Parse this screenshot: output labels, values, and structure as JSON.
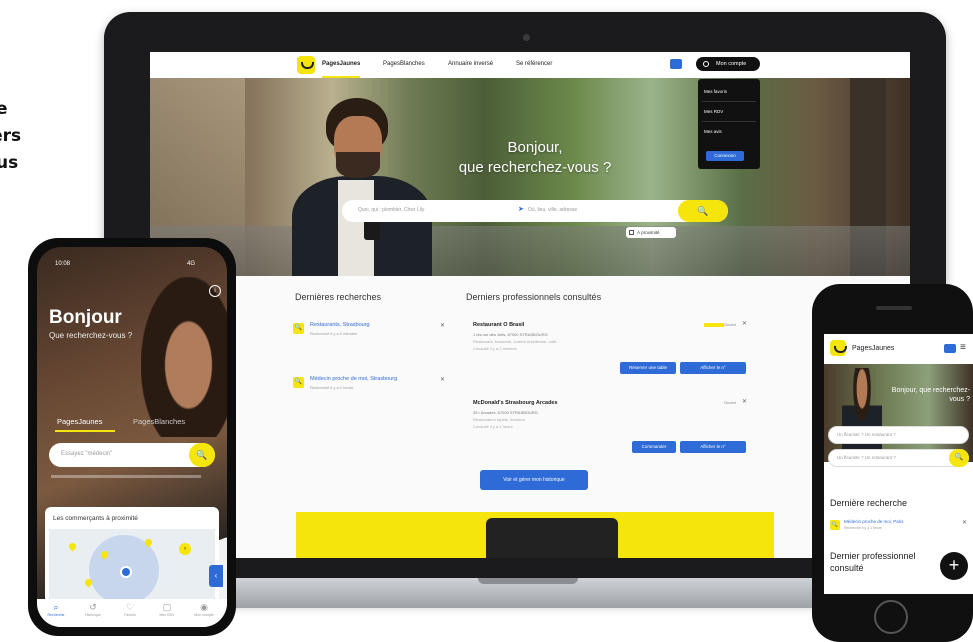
{
  "promo": {
    "line1": "e",
    "line2": "vers",
    "line3": "us"
  },
  "laptop": {
    "nav": {
      "brand": "PagesJaunes",
      "links": [
        "PagesBlanches",
        "Annuaire inversé",
        "Se référencer"
      ],
      "account": "Mon compte"
    },
    "dropdown": {
      "items": [
        "Mes favoris",
        "Mes RDV",
        "Mes avis"
      ],
      "button": "Connexion"
    },
    "hero": {
      "title_line1": "Bonjour,",
      "title_line2": "que recherchez-vous ?",
      "what_placeholder": "Quoi, qui : plombier, Chez Lily",
      "where_placeholder": "Où, lieu, ville, adresse",
      "search_icon": "search-icon",
      "proximity_label": "À proximité"
    },
    "recent_title": "Dernières recherches",
    "recent": [
      {
        "query": "Restaurants, Strasbourg",
        "sub": "Recherché il y a 2 minutes"
      },
      {
        "query": "Médecin proche de moi, Strasbourg",
        "sub": "Recherché il y a 1 heure"
      }
    ],
    "pros_title": "Derniers professionnels consultés",
    "pros": [
      {
        "name": "Restaurant O Brasil",
        "addr": "1 bis rue des Juifs, 67000 STRASBOURG",
        "desc": "Restaurant, brasserie, cuisine brésilienne, café...",
        "desc2": "Consulté il y a 2 minutes",
        "meta": "Ouvert",
        "btn1": "Réserver une table",
        "btn2": "Afficher le n°"
      },
      {
        "name": "McDonald's Strasbourg Arcades",
        "addr": "35 r Arcades, 67000 STRASBOURG",
        "desc": "Restauration rapide, livraison",
        "desc2": "Consulté il y a 1 heure",
        "meta": "Ouvert",
        "btn1": "Commander",
        "btn2": "Afficher le n°"
      }
    ],
    "history_button": "Voir et gérer mon historique"
  },
  "left_phone": {
    "time": "10:08",
    "status": "4G",
    "hello": "Bonjour",
    "sub": "Que recherchez-vous ?",
    "tabs": [
      "PagesJaunes",
      "PagesBlanches"
    ],
    "search_placeholder": "Essayez \"médecin\"",
    "card_title": "Les commerçants à proximité",
    "bottom_nav": [
      "Recherche",
      "Historique",
      "Favoris",
      "Mes RDV",
      "Mon compte"
    ]
  },
  "right_phone": {
    "brand": "PagesJaunes",
    "title": "Bonjour, que recherchez-vous ?",
    "in1_placeholder": "Un fleuriste ? Un restaurant ?",
    "in2_placeholder": "Un fleuriste ? Un restaurant ?",
    "last_title": "Dernière recherche",
    "last_item_query": "Médecin proche de moi, Paris",
    "last_item_sub": "Recherché il y a 1 heure",
    "last_pro_title": "Dernier professionnel consulté",
    "fab": "+"
  },
  "colors": {
    "brand_yellow": "#f5e50c",
    "accent_blue": "#2e6bd6",
    "dark": "#111111"
  }
}
